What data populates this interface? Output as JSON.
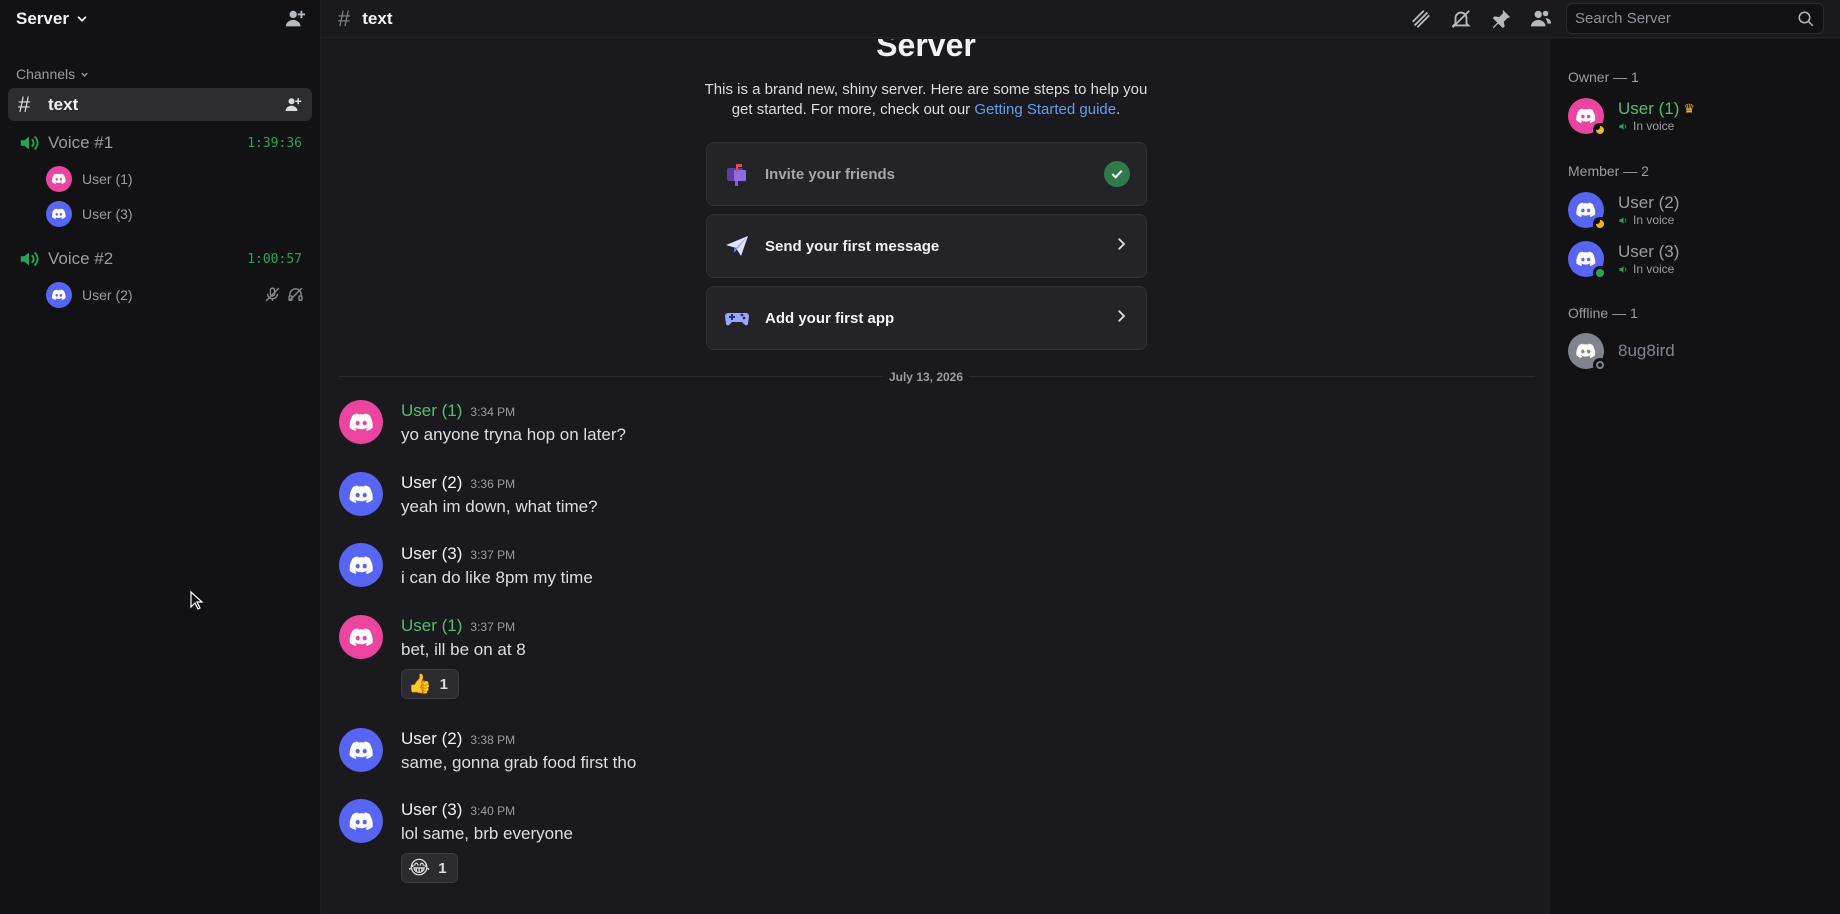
{
  "server": {
    "name": "Server"
  },
  "sidebar": {
    "category": "Channels",
    "text_channel": {
      "name": "text"
    },
    "voice_channels": [
      {
        "name": "Voice #1",
        "timer": "1:39:36",
        "users": [
          {
            "name": "User (1)",
            "color": "pink"
          },
          {
            "name": "User (3)",
            "color": "blue"
          }
        ]
      },
      {
        "name": "Voice #2",
        "timer": "1:00:57",
        "users": [
          {
            "name": "User (2)",
            "color": "blue",
            "muted": true,
            "deafened": true
          }
        ]
      }
    ]
  },
  "topbar": {
    "hash": "#",
    "channel": "text",
    "search_placeholder": "Search Server",
    "icons": [
      "threads-icon",
      "notifications-muted-icon",
      "pin-icon",
      "member-list-icon",
      "search-icon"
    ]
  },
  "welcome": {
    "title": "Server",
    "desc_line1": "This is a brand new, shiny server. Here are some steps to help you",
    "desc_line2_pre": "get started. For more, check out our ",
    "desc_link": "Getting Started guide",
    "desc_line2_post": ".",
    "steps": [
      {
        "label": "Invite your friends",
        "done": true
      },
      {
        "label": "Send your first message",
        "done": false
      },
      {
        "label": "Add your first app",
        "done": false
      }
    ]
  },
  "date_divider": "July 13, 2026",
  "messages": [
    {
      "author": "User (1)",
      "time": "3:34 PM",
      "text": "yo anyone tryna hop on later?"
    },
    {
      "author": "User (2)",
      "time": "3:36 PM",
      "text": "yeah im down, what time?"
    },
    {
      "author": "User (3)",
      "time": "3:37 PM",
      "text": "i can do like 8pm my time"
    },
    {
      "author": "User (1)",
      "time": "3:37 PM",
      "text": "bet, ill be on at 8",
      "reaction": {
        "emoji": "👍",
        "count": "1"
      }
    },
    {
      "author": "User (2)",
      "time": "3:38 PM",
      "text": "same, gonna grab food first tho"
    },
    {
      "author": "User (3)",
      "time": "3:40 PM",
      "text": "lol same, brb everyone",
      "reaction": {
        "emoji": "😂",
        "count": "1"
      }
    }
  ],
  "members": {
    "groups": [
      {
        "label": "Owner — 1"
      },
      {
        "label": "Member — 2"
      },
      {
        "label": "Offline — 1"
      }
    ],
    "list": [
      {
        "name": "User (1)",
        "status_text": "In voice",
        "presence": "idle"
      },
      {
        "name": "User (2)",
        "status_text": "In voice",
        "presence": "idle"
      },
      {
        "name": "User (3)",
        "status_text": "In voice",
        "presence": "online"
      },
      {
        "name": "8ug8ird",
        "presence": "offline"
      }
    ]
  },
  "colors": {
    "accent_green": "#23a55a",
    "owner_name": "#4fbf6f",
    "link": "#5ea0f0",
    "pink_avatar": "#eb459f",
    "blue_avatar": "#5865f2"
  }
}
